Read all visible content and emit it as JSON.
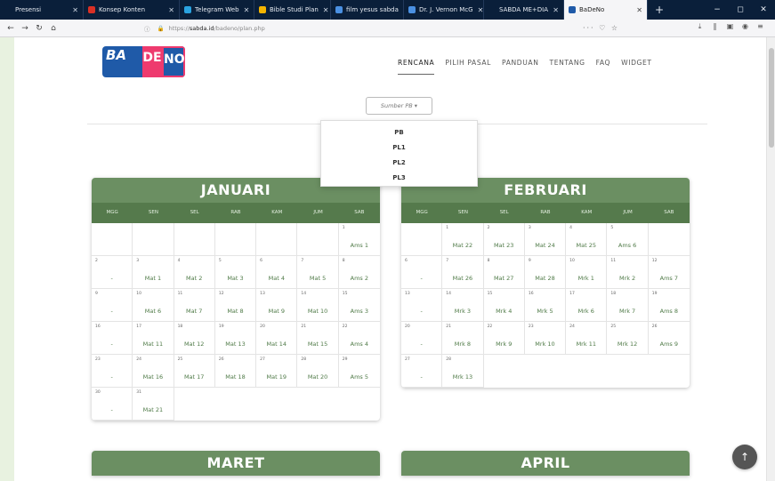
{
  "browser": {
    "tabs": [
      {
        "label": "Presensi",
        "color": "#0a1f3a"
      },
      {
        "label": "Konsep Konten",
        "color": "#d93025"
      },
      {
        "label": "Telegram Web",
        "color": "#2aa3e0"
      },
      {
        "label": "Bible Studi Plan",
        "color": "#f4b400"
      },
      {
        "label": "film yesus sabda",
        "color": "#4a90e2"
      },
      {
        "label": "Dr. J. Vernon McG",
        "color": "#4a90e2"
      },
      {
        "label": "SABDA ME+DIA",
        "color": "#0a1f3a"
      },
      {
        "label": "BaDeNo",
        "color": "#1f5aa8"
      }
    ],
    "url_prefix": "https://",
    "url_domain": "sabda.id",
    "url_path": "/badeno/plan.php",
    "url_actions": "··· ♡ ☆",
    "new_tab": "+",
    "win_min": "−",
    "win_max": "◻",
    "win_close": "✕",
    "back": "←",
    "forward": "→",
    "reload": "↻",
    "home": "⌂"
  },
  "logo": {
    "ba": "BA",
    "de": "DE",
    "no": "NO"
  },
  "menu": [
    "RENCANA",
    "PILIH PASAL",
    "PANDUAN",
    "TENTANG",
    "FAQ",
    "WIDGET"
  ],
  "sumber": {
    "label": "Sumber PB ▾",
    "options": [
      "PB",
      "PL1",
      "PL2",
      "PL3"
    ]
  },
  "day_headers": [
    "MGG",
    "SEN",
    "SEL",
    "RAB",
    "KAM",
    "JUM",
    "SAB"
  ],
  "months": [
    {
      "name": "JANUARI",
      "cells": [
        [
          "",
          ""
        ],
        [
          "",
          ""
        ],
        [
          "",
          ""
        ],
        [
          "",
          ""
        ],
        [
          "",
          ""
        ],
        [
          "",
          ""
        ],
        [
          "1",
          "Ams 1"
        ],
        [
          "2",
          "-"
        ],
        [
          "3",
          "Mat 1"
        ],
        [
          "4",
          "Mat 2"
        ],
        [
          "5",
          "Mat 3"
        ],
        [
          "6",
          "Mat 4"
        ],
        [
          "7",
          "Mat 5"
        ],
        [
          "8",
          "Ams 2"
        ],
        [
          "9",
          "-"
        ],
        [
          "10",
          "Mat 6"
        ],
        [
          "11",
          "Mat 7"
        ],
        [
          "12",
          "Mat 8"
        ],
        [
          "13",
          "Mat 9"
        ],
        [
          "14",
          "Mat 10"
        ],
        [
          "15",
          "Ams 3"
        ],
        [
          "16",
          "-"
        ],
        [
          "17",
          "Mat 11"
        ],
        [
          "18",
          "Mat 12"
        ],
        [
          "19",
          "Mat 13"
        ],
        [
          "20",
          "Mat 14"
        ],
        [
          "21",
          "Mat 15"
        ],
        [
          "22",
          "Ams 4"
        ],
        [
          "23",
          "-"
        ],
        [
          "24",
          "Mat 16"
        ],
        [
          "25",
          "Mat 17"
        ],
        [
          "26",
          "Mat 18"
        ],
        [
          "27",
          "Mat 19"
        ],
        [
          "28",
          "Mat 20"
        ],
        [
          "29",
          "Ams 5"
        ],
        [
          "30",
          "-"
        ],
        [
          "31",
          "Mat 21"
        ]
      ]
    },
    {
      "name": "FEBRUARI",
      "cells": [
        [
          "",
          ""
        ],
        [
          "1",
          "Mat 22"
        ],
        [
          "2",
          "Mat 23"
        ],
        [
          "3",
          "Mat 24"
        ],
        [
          "4",
          "Mat 25"
        ],
        [
          "5",
          "Ams 6"
        ],
        [
          "",
          ""
        ],
        [
          "6",
          "-"
        ],
        [
          "7",
          "Mat 26"
        ],
        [
          "8",
          "Mat 27"
        ],
        [
          "9",
          "Mat 28"
        ],
        [
          "10",
          "Mrk 1"
        ],
        [
          "11",
          "Mrk 2"
        ],
        [
          "12",
          "Ams 7"
        ],
        [
          "13",
          "-"
        ],
        [
          "14",
          "Mrk 3"
        ],
        [
          "15",
          "Mrk 4"
        ],
        [
          "16",
          "Mrk 5"
        ],
        [
          "17",
          "Mrk 6"
        ],
        [
          "18",
          "Mrk 7"
        ],
        [
          "19",
          "Ams 8"
        ],
        [
          "20",
          "-"
        ],
        [
          "21",
          "Mrk 8"
        ],
        [
          "22",
          "Mrk 9"
        ],
        [
          "23",
          "Mrk 10"
        ],
        [
          "24",
          "Mrk 11"
        ],
        [
          "25",
          "Mrk 12"
        ],
        [
          "26",
          "Ams 9"
        ],
        [
          "27",
          "-"
        ],
        [
          "28",
          "Mrk 13"
        ]
      ]
    },
    {
      "name": "MARET",
      "cells": []
    },
    {
      "name": "APRIL",
      "cells": []
    }
  ],
  "scroll_top": "↑"
}
